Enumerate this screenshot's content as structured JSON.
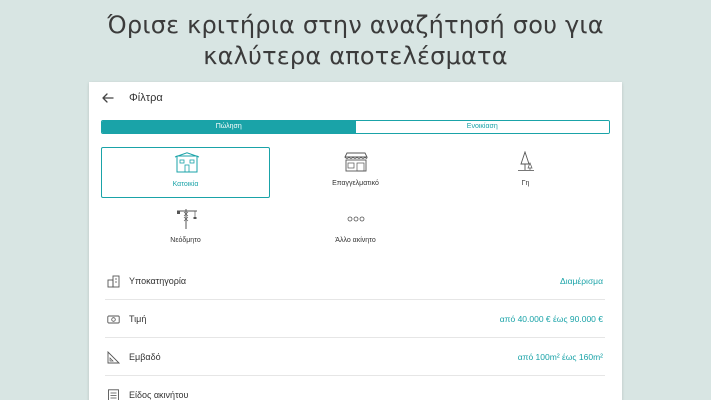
{
  "headline": {
    "line1": "Όρισε κριτήρια στην αναζήτησή σου για",
    "line2": "καλύτερα αποτελέσματα"
  },
  "appbar": {
    "title": "Φίλτρα",
    "back_icon": "arrow-left-icon"
  },
  "tabs": [
    {
      "label": "Πώληση",
      "active": true
    },
    {
      "label": "Ενοικίαση",
      "active": false
    }
  ],
  "property_types": [
    {
      "label": "Κατοικία",
      "icon": "house-icon",
      "selected": true
    },
    {
      "label": "Επαγγελματικό",
      "icon": "shop-icon",
      "selected": false
    },
    {
      "label": "Γη",
      "icon": "tree-icon",
      "selected": false
    },
    {
      "label": "Νεόδμητο",
      "icon": "crane-icon",
      "selected": false
    },
    {
      "label": "Άλλο ακίνητο",
      "icon": "dots-icon",
      "selected": false
    }
  ],
  "filters": [
    {
      "label": "Υποκατηγορία",
      "value": "Διαμέρισμα",
      "icon": "building-icon"
    },
    {
      "label": "Τιμή",
      "value": "από 40.000 € έως 90.000 €",
      "icon": "money-icon"
    },
    {
      "label": "Εμβαδό",
      "value": "από 100m² έως 160m²",
      "icon": "ruler-icon"
    },
    {
      "label": "Είδος ακινήτου",
      "value": "",
      "icon": "list-icon"
    }
  ],
  "colors": {
    "accent": "#1aa3a8",
    "background": "#d8e5e3"
  }
}
